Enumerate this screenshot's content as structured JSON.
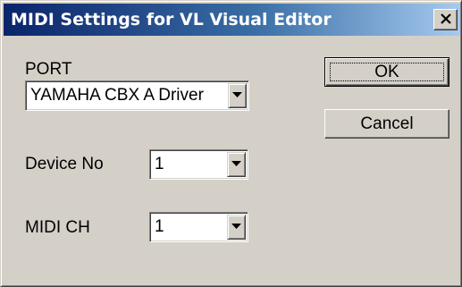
{
  "window": {
    "title": "MIDI Settings for VL Visual Editor",
    "close_icon": "close-x-icon"
  },
  "port": {
    "label": "PORT",
    "selected": "YAMAHA CBX A Driver"
  },
  "device_no": {
    "label": "Device No",
    "selected": "1"
  },
  "midi_ch": {
    "label": "MIDI CH",
    "selected": "1"
  },
  "buttons": {
    "ok_label": "OK",
    "cancel_label": "Cancel"
  },
  "colors": {
    "face": "#d4d0c8",
    "title_start": "#0a246a",
    "title_end": "#a6caf0"
  }
}
